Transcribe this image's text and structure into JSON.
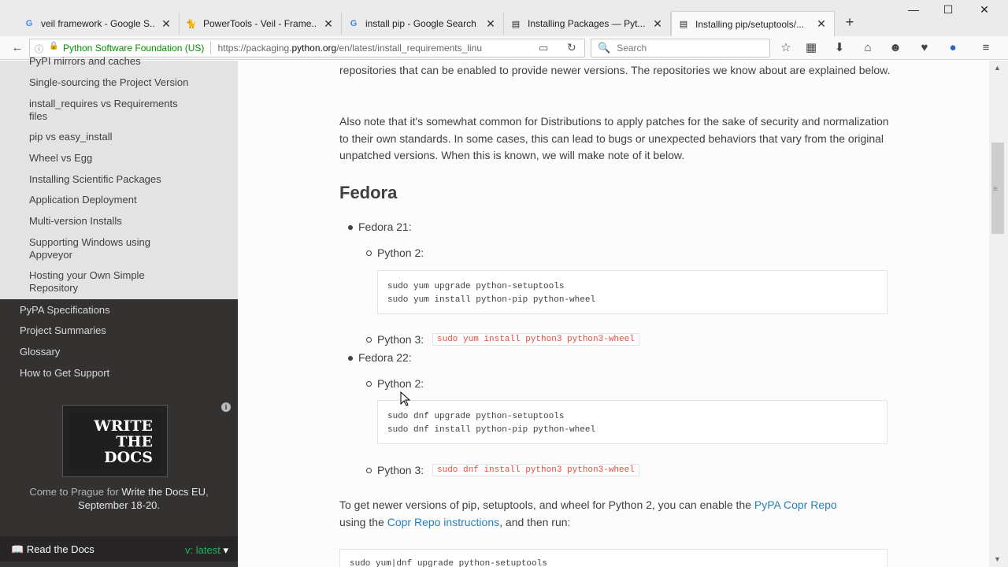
{
  "tabs": [
    {
      "label": "veil framework - Google S...",
      "favicon": "G"
    },
    {
      "label": "PowerTools - Veil - Frame...",
      "favicon": "P"
    },
    {
      "label": "install pip - Google Search",
      "favicon": "G"
    },
    {
      "label": "Installing Packages — Pyt...",
      "favicon": "doc"
    },
    {
      "label": "Installing pip/setuptools/...",
      "favicon": "doc"
    }
  ],
  "nav": {
    "identity": "Python Software Foundation (US)",
    "url_prefix": "https://packaging.",
    "url_domain": "python.org",
    "url_rest": "/en/latest/install_requirements_linu",
    "search_placeholder": "Search"
  },
  "sidebar": {
    "sub_items": [
      "PyPI mirrors and caches",
      "Single-sourcing the Project Version",
      "install_requires vs Requirements files",
      "pip vs easy_install",
      "Wheel vs Egg",
      "Installing Scientific Packages",
      "Application Deployment",
      "Multi-version Installs",
      "Supporting Windows using Appveyor",
      "Hosting your Own Simple Repository"
    ],
    "top_items": [
      "PyPA Specifications",
      "Project Summaries",
      "Glossary",
      "How to Get Support"
    ],
    "ad_logo": "WRITE THE DOCS",
    "ad_logo_lines": [
      "WRITE",
      "THE",
      "DOCS"
    ],
    "ad_text_pre": "Come to Prague for ",
    "ad_text_strong": "Write the Docs EU",
    "ad_text_post": ",",
    "ad_text_line2": "September 18-20.",
    "rtd_label": "Read the Docs",
    "version_label": "v: latest"
  },
  "content": {
    "para1": "repositories that can be enabled to provide newer versions. The repositories we know about are explained below.",
    "para2": "Also note that it's somewhat common for Distributions to apply patches for the sake of security and normalization to their own standards. In some cases, this can lead to bugs or unexpected behaviors that vary from the original unpatched versions. When this is known, we will make note of it below.",
    "heading": "Fedora",
    "fedora21": "Fedora 21:",
    "fedora22": "Fedora 22:",
    "python2": "Python 2:",
    "python3": "Python 3:",
    "f21_py2_code": "sudo yum upgrade python-setuptools\nsudo yum install python-pip python-wheel",
    "f21_py3_code": "sudo yum install python3 python3-wheel",
    "f22_py2_code": "sudo dnf upgrade python-setuptools\nsudo dnf install python-pip python-wheel",
    "f22_py3_code": "sudo dnf install python3 python3-wheel",
    "para3_a": "To get newer versions of pip, setuptools, and wheel for Python 2, you can enable the ",
    "para3_link1": "PyPA Copr Repo",
    "para3_b": "using the ",
    "para3_link2": "Copr Repo instructions",
    "para3_c": ", and then run:",
    "partial_code": "sudo yum|dnf upgrade python-setuptools"
  },
  "colors": {
    "sidebar_dark": "#343131",
    "sidebar_sub": "#e3e3e3",
    "link": "#2980b9",
    "code_red": "#e74c3c",
    "version_green": "#27ae60"
  }
}
